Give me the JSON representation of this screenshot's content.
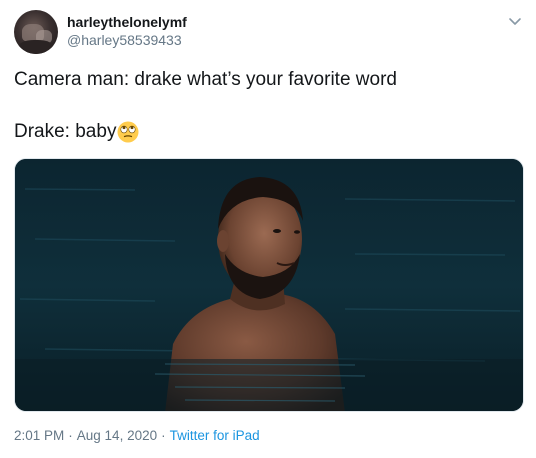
{
  "author": {
    "display_name": "harleythelonelymf",
    "handle": "@harley58539433"
  },
  "tweet": {
    "line1": "Camera man: drake what’s your favorite word",
    "line2": "Drake: baby",
    "emoji": "face-with-rolling-eyes-icon"
  },
  "meta": {
    "time": "2:01 PM",
    "separator": "·",
    "date": "Aug 14, 2020",
    "source": "Twitter for iPad"
  },
  "colors": {
    "text": "#14171a",
    "secondary": "#657786",
    "link": "#1b95e0",
    "water": "#0b1a22",
    "emoji": "#ffcc4d"
  }
}
